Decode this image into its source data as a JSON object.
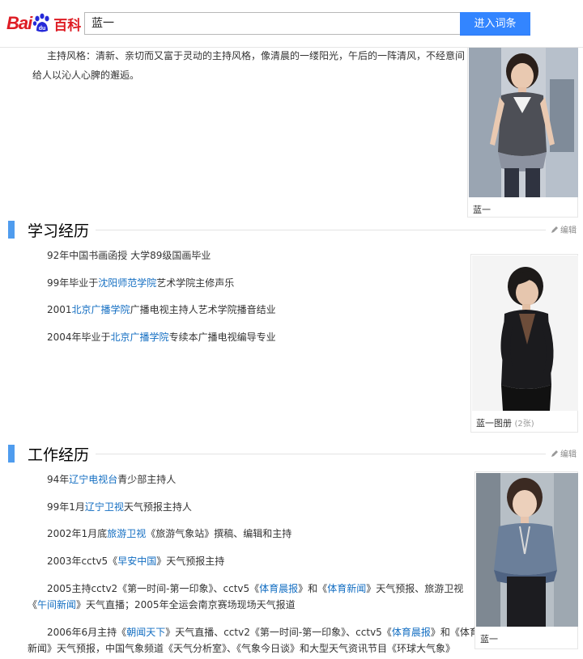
{
  "header": {
    "logo_text_red": "Bai",
    "logo_text_paw": "du",
    "logo_text_cn": "百科",
    "search_value": "蓝一",
    "search_button": "进入词条"
  },
  "intro": {
    "text": "主持风格：清新、亲切而又富于灵动的主持风格，像清晨的一缕阳光，午后的一阵清风，不经意间给人以沁人心脾的邂逅。"
  },
  "figure1": {
    "caption": "蓝一"
  },
  "study": {
    "title": "学习经历",
    "edit": "编辑",
    "items": [
      {
        "pre": "92年中国书画函授 大学89级国画毕业",
        "link": "",
        "post": ""
      },
      {
        "pre": "99年毕业于",
        "link": "沈阳师范学院",
        "post": "艺术学院主修声乐"
      },
      {
        "pre": "2001",
        "link": "北京广播学院",
        "post": "广播电视主持人艺术学院播音结业"
      },
      {
        "pre": "2004年毕业于",
        "link": "北京广播学院",
        "post": "专续本广播电视编导专业"
      }
    ]
  },
  "figure2": {
    "caption": "蓝一图册",
    "count": "(2张)"
  },
  "work": {
    "title": "工作经历",
    "edit": "编辑",
    "l1_pre": "94年",
    "l1_link": "辽宁电视台",
    "l1_post": "青少部主持人",
    "l2_pre": "99年1月",
    "l2_link": "辽宁卫视",
    "l2_post": "天气预报主持人",
    "l3_pre": "2002年1月底",
    "l3_link": "旅游卫视",
    "l3_post": "《旅游气象站》撰稿、编辑和主持",
    "l4_pre": "2003年cctv5《",
    "l4_link": "早安中国",
    "l4_post": "》天气预报主持",
    "l5a_pre": "2005主持cctv2《第一时间-第一印象》、cctv5《",
    "l5a_link1": "体育晨报",
    "l5a_mid": "》和《",
    "l5a_link2": "体育新闻",
    "l5a_post": "》天气预报、旅游卫视",
    "l5b_pre": "《",
    "l5b_link": "午间新闻",
    "l5b_post": "》天气直播；2005年全运会南京赛场现场天气报道",
    "l6a_pre": "2006年6月主持《",
    "l6a_link1": "朝闻天下",
    "l6a_mid1": "》天气直播、cctv2《第一时间-第一印象》、cctv5《",
    "l6a_link2": "体育晨报",
    "l6a_mid2": "》和《体育",
    "l6b_text": "新闻》天气预报，中国气象频道《天气分析室》、《气象今日谈》和大型天气资讯节目《环球大气象》"
  },
  "figure3": {
    "caption": "蓝一"
  }
}
